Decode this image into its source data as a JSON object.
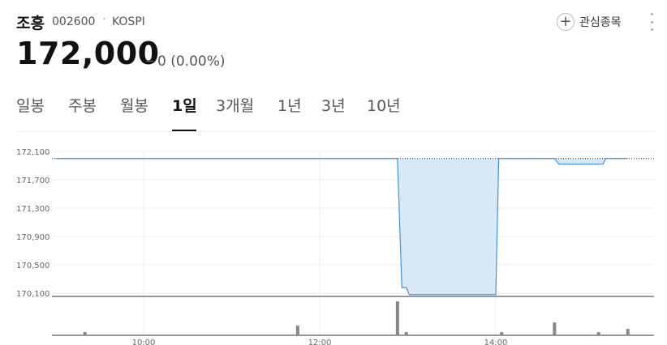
{
  "stock": {
    "name": "조흥",
    "code": "002600",
    "separator": "·",
    "market": "KOSPI",
    "price": "172,000",
    "change": "0 (0.00%)",
    "watch_label": "관심종목"
  },
  "tabs": [
    {
      "label": "일봉",
      "active": false
    },
    {
      "label": "주봉",
      "active": false
    },
    {
      "label": "월봉",
      "active": false
    },
    {
      "label": "1일",
      "active": true
    },
    {
      "label": "3개월",
      "active": false
    },
    {
      "label": "1년",
      "active": false
    },
    {
      "label": "3년",
      "active": false
    },
    {
      "label": "10년",
      "active": false
    }
  ],
  "chart_data": {
    "type": "area",
    "y_ticks": [
      "172,100",
      "171,700",
      "171,300",
      "170,900",
      "170,500",
      "170,100"
    ],
    "ylim": [
      170100,
      172100
    ],
    "x_ticks": [
      "10:00",
      "12:00",
      "14:00"
    ],
    "reference_price": 172000,
    "grid": true,
    "colors": {
      "line": "#3d93d8",
      "fill": "#d9e9fa",
      "volume": "#888888",
      "grid": "#eeeeee"
    },
    "price_series": [
      {
        "t": "09:00",
        "v": 172000
      },
      {
        "t": "12:53",
        "v": 172000
      },
      {
        "t": "12:56",
        "v": 170180
      },
      {
        "t": "12:59",
        "v": 170180
      },
      {
        "t": "13:01",
        "v": 170080
      },
      {
        "t": "14:00",
        "v": 170080
      },
      {
        "t": "14:02",
        "v": 172000
      },
      {
        "t": "14:40",
        "v": 172000
      },
      {
        "t": "14:43",
        "v": 171920
      },
      {
        "t": "15:13",
        "v": 171920
      },
      {
        "t": "15:15",
        "v": 172000
      },
      {
        "t": "15:30",
        "v": 172000
      }
    ],
    "volume_bars": [
      {
        "t": "09:20",
        "v": 0.09
      },
      {
        "t": "11:45",
        "v": 0.27
      },
      {
        "t": "12:53",
        "v": 0.95
      },
      {
        "t": "12:59",
        "v": 0.09
      },
      {
        "t": "14:04",
        "v": 0.09
      },
      {
        "t": "14:40",
        "v": 0.36
      },
      {
        "t": "15:10",
        "v": 0.09
      },
      {
        "t": "15:30",
        "v": 0.18
      }
    ]
  }
}
